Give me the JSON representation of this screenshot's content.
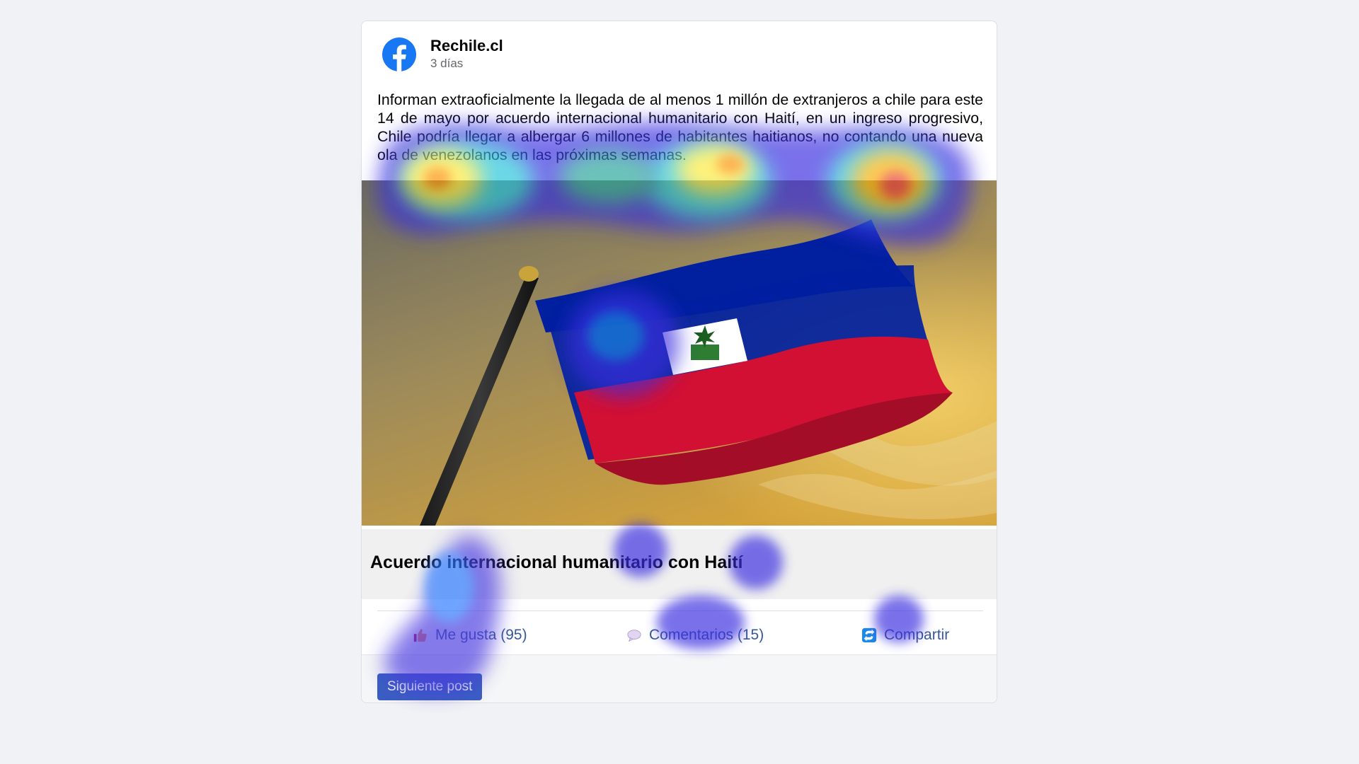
{
  "post": {
    "author": "Rechile.cl",
    "time": "3 días",
    "text": "Informan extraoficialmente la llegada de al menos 1 millón de extranjeros a chile para este 14 de mayo por acuerdo internacional humanitario con Haití, en un ingreso progresivo, Chile podría llegar a albergar 6 millones de habitantes haitianos, no contando una nueva ola de venezolanos en las próximas semanas.",
    "image_subject": "haiti-flag-on-pole",
    "link_title": "Acuerdo internacional humanitario con Haití"
  },
  "actions": {
    "like": {
      "label": "Me gusta (95)",
      "icon": "thumbs-up-icon"
    },
    "comment": {
      "label": "Comentarios (15)",
      "icon": "speech-bubble-icon"
    },
    "share": {
      "label": "Compartir",
      "icon": "share-icon"
    }
  },
  "footer": {
    "next_label": "Siguiente post"
  },
  "colors": {
    "page_bg": "#f0f2f5",
    "facebook_blue": "#1877f2",
    "link_blue": "#385898",
    "button_blue": "#3b5ec2",
    "flag_blue": "#00209f",
    "flag_red": "#d21034"
  },
  "overlay": {
    "type": "eye-tracking-heatmap"
  }
}
